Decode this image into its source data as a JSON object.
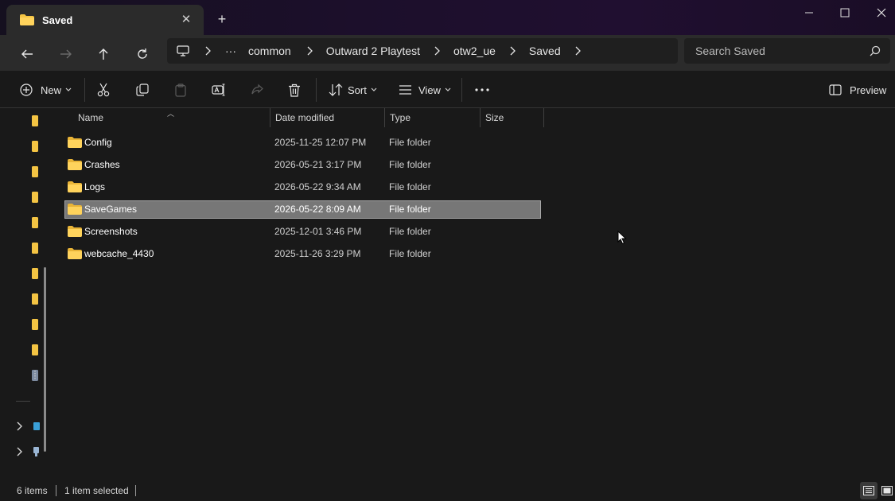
{
  "window": {
    "tab_title": "Saved",
    "tab_close": "✕",
    "new_tab": "+",
    "minimize": "minimize",
    "maximize": "maximize",
    "close": "close"
  },
  "nav": {
    "back": "back-arrow-icon",
    "forward": "forward-arrow-icon",
    "up": "up-arrow-icon",
    "refresh": "refresh-icon",
    "breadcrumb": [
      "common",
      "Outward 2 Playtest",
      "otw2_ue",
      "Saved"
    ],
    "overflow": "···",
    "search_placeholder": "Search Saved"
  },
  "toolbar": {
    "new_label": "New",
    "sort_label": "Sort",
    "view_label": "View",
    "more": "•••",
    "preview_label": "Preview"
  },
  "columns": {
    "name": "Name",
    "date": "Date modified",
    "type": "Type",
    "size": "Size"
  },
  "files": [
    {
      "name": "Config",
      "date": "2025-11-25 12:07 PM",
      "type": "File folder"
    },
    {
      "name": "Crashes",
      "date": "2026-05-21 3:17 PM",
      "type": "File folder"
    },
    {
      "name": "Logs",
      "date": "2026-05-22 9:34 AM",
      "type": "File folder"
    },
    {
      "name": "SaveGames",
      "date": "2026-05-22 8:09 AM",
      "type": "File folder",
      "selected": true
    },
    {
      "name": "Screenshots",
      "date": "2025-12-01 3:46 PM",
      "type": "File folder"
    },
    {
      "name": "webcache_4430",
      "date": "2025-11-26 3:29 PM",
      "type": "File folder"
    }
  ],
  "status": {
    "item_count": "6 items",
    "selection": "1 item selected"
  },
  "colors": {
    "folder": "#f4c443",
    "selected_row": "#777777",
    "accent_title": "#200f30"
  }
}
